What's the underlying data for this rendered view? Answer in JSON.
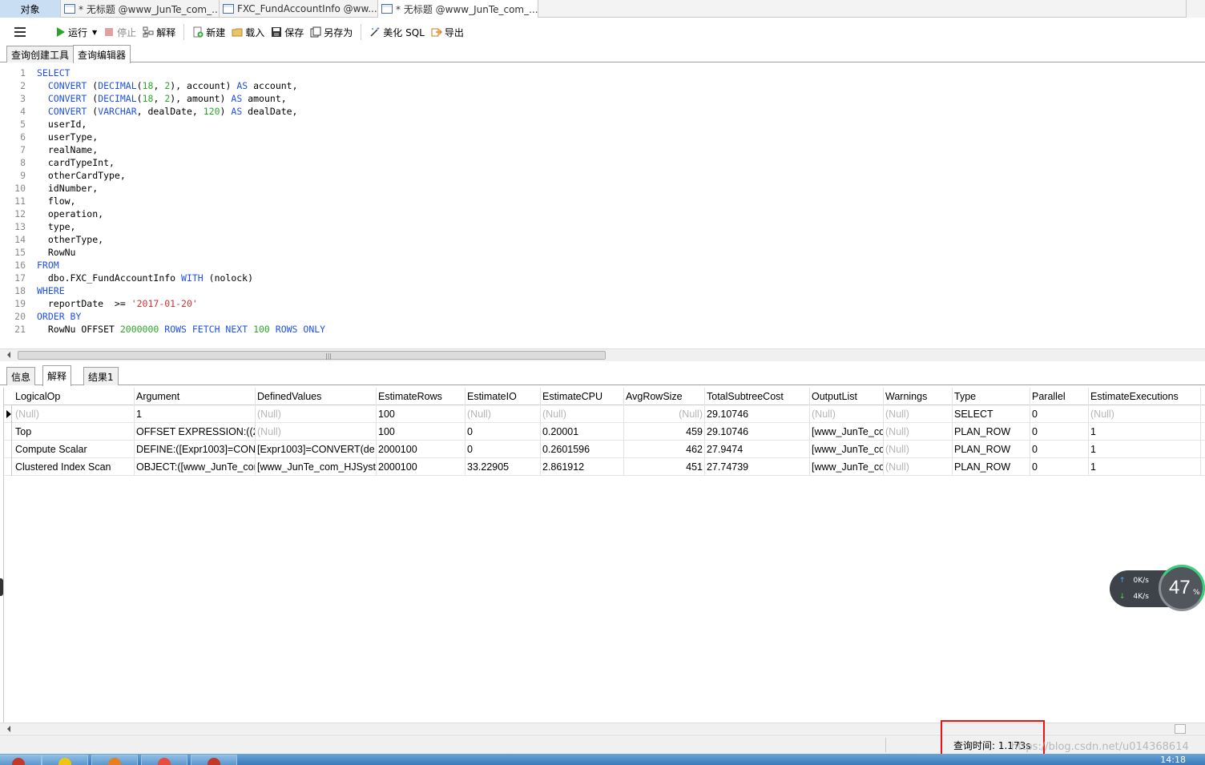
{
  "doc_tabs": {
    "objects": "对象",
    "tab1": "* 无标题 @www_JunTe_com_...",
    "tab2": "FXC_FundAccountInfo @ww...",
    "tab3": "* 无标题 @www_JunTe_com_..."
  },
  "toolbar": {
    "run": "运行",
    "stop": "停止",
    "explain": "解释",
    "new": "新建",
    "load": "载入",
    "save": "保存",
    "save_as": "另存为",
    "beautify": "美化 SQL",
    "export": "导出"
  },
  "mode_tabs": {
    "builder": "查询创建工具",
    "editor": "查询编辑器"
  },
  "editor": {
    "lines": [
      {
        "n": "1",
        "html": "<span class=\"kw\">SELECT</span>"
      },
      {
        "n": "2",
        "html": "  <span class=\"kw\">CONVERT</span> (<span class=\"kw\">DECIMAL</span>(<span class=\"num\">18</span>, <span class=\"num\">2</span>), account) <span class=\"kw\">AS</span> account,"
      },
      {
        "n": "3",
        "html": "  <span class=\"kw\">CONVERT</span> (<span class=\"kw\">DECIMAL</span>(<span class=\"num\">18</span>, <span class=\"num\">2</span>), amount) <span class=\"kw\">AS</span> amount,"
      },
      {
        "n": "4",
        "html": "  <span class=\"kw\">CONVERT</span> (<span class=\"kw\">VARCHAR</span>, dealDate, <span class=\"num\">120</span>) <span class=\"kw\">AS</span> dealDate,"
      },
      {
        "n": "5",
        "html": "  userId,"
      },
      {
        "n": "6",
        "html": "  userType,"
      },
      {
        "n": "7",
        "html": "  realName,"
      },
      {
        "n": "8",
        "html": "  cardTypeInt,"
      },
      {
        "n": "9",
        "html": "  otherCardType,"
      },
      {
        "n": "10",
        "html": "  idNumber,"
      },
      {
        "n": "11",
        "html": "  flow,"
      },
      {
        "n": "12",
        "html": "  operation,"
      },
      {
        "n": "13",
        "html": "  type,"
      },
      {
        "n": "14",
        "html": "  otherType,"
      },
      {
        "n": "15",
        "html": "  RowNu"
      },
      {
        "n": "16",
        "html": "<span class=\"kw\">FROM</span>"
      },
      {
        "n": "17",
        "html": "  dbo.FXC_FundAccountInfo <span class=\"kw\">WITH</span> (nolock)"
      },
      {
        "n": "18",
        "html": "<span class=\"kw\">WHERE</span>"
      },
      {
        "n": "19",
        "html": "  reportDate  >= <span class=\"str\">'2017-01-20'</span>"
      },
      {
        "n": "20",
        "html": "<span class=\"kw\">ORDER BY</span>"
      },
      {
        "n": "21",
        "html": "  RowNu OFFSET <span class=\"num\">2000000</span> <span class=\"kw\">ROWS FETCH NEXT</span> <span class=\"num\">100</span> <span class=\"kw\">ROWS ONLY</span>"
      }
    ]
  },
  "result_tabs": {
    "info": "信息",
    "explain": "解释",
    "result1": "结果1"
  },
  "grid": {
    "columns": [
      "LogicalOp",
      "Argument",
      "DefinedValues",
      "EstimateRows",
      "EstimateIO",
      "EstimateCPU",
      "AvgRowSize",
      "TotalSubtreeCost",
      "OutputList",
      "Warnings",
      "Type",
      "Parallel",
      "EstimateExecutions"
    ],
    "rows": [
      [
        "(Null)",
        "1",
        "(Null)",
        "100",
        "(Null)",
        "(Null)",
        "(Null)",
        "29.10746",
        "(Null)",
        "(Null)",
        "SELECT",
        "0",
        "(Null)"
      ],
      [
        "Top",
        "OFFSET EXPRESSION:((20",
        "(Null)",
        "100",
        "0",
        "0.20001",
        "459",
        "29.10746",
        "[www_JunTe_co",
        "(Null)",
        "PLAN_ROW",
        "0",
        "1"
      ],
      [
        "Compute Scalar",
        "DEFINE:([Expr1003]=CON",
        "[Expr1003]=CONVERT(de",
        "2000100",
        "0",
        "0.2601596",
        "462",
        "27.9474",
        "[www_JunTe_co",
        "(Null)",
        "PLAN_ROW",
        "0",
        "1"
      ],
      [
        "Clustered Index Scan",
        "OBJECT:([www_JunTe_con",
        "[www_JunTe_com_HJSyste",
        "2000100",
        "33.22905",
        "2.861912",
        "451",
        "27.74739",
        "[www_JunTe_co",
        "(Null)",
        "PLAN_ROW",
        "0",
        "1"
      ]
    ]
  },
  "status": {
    "query_time": "查询时间: 1.173s"
  },
  "watermark": "https://blog.csdn.net/u014368614",
  "net_widget": {
    "up": "0K/s",
    "down": "4K/s",
    "percent": "47",
    "percent_sign": "%"
  },
  "taskbar": {
    "clock": "14:18"
  },
  "colors": {
    "keyword": "#1f50e6",
    "number": "#2aa52a",
    "string": "#cc3333",
    "highlight": "#ee1111"
  }
}
